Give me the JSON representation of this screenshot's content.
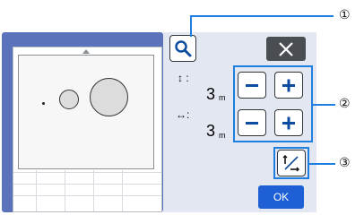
{
  "controls": {
    "height_value": "3",
    "width_value": "3",
    "unit": "m",
    "ok_label": "OK",
    "height_icon": "vertical-arrows-icon",
    "width_icon": "horizontal-arrows-icon"
  },
  "callouts": {
    "one": "①",
    "two": "②",
    "three": "③"
  },
  "colors": {
    "accent": "#1f7fe0",
    "frame": "#5b73ba",
    "ok": "#1e5fd6",
    "close": "#4a4d52",
    "panel": "#e3e7f1"
  }
}
